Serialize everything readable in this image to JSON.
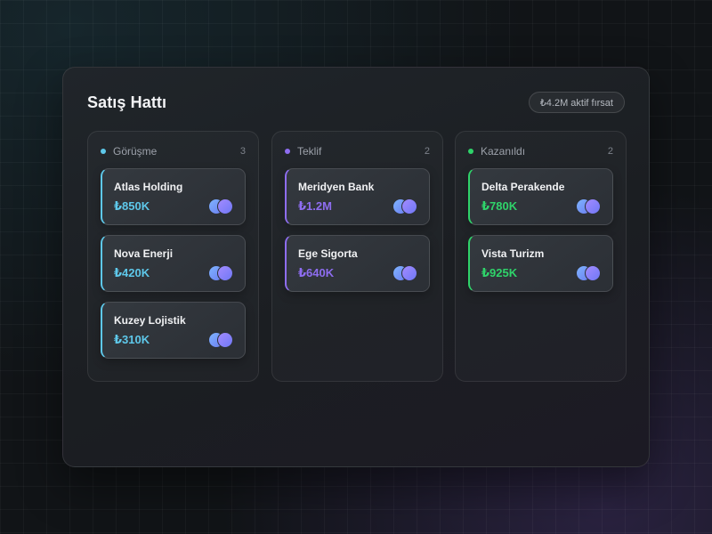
{
  "board": {
    "title": "Satış Hattı",
    "active_badge": "₺4.2M aktif fırsat"
  },
  "columns": [
    {
      "name": "Görüşme",
      "count": "3",
      "color": "#5ec8ea",
      "cards": [
        {
          "name": "Atlas Holding",
          "amount": "₺850K"
        },
        {
          "name": "Nova Enerji",
          "amount": "₺420K"
        },
        {
          "name": "Kuzey Lojistik",
          "amount": "₺310K"
        }
      ]
    },
    {
      "name": "Teklif",
      "count": "2",
      "color": "#8e6df0",
      "cards": [
        {
          "name": "Meridyen Bank",
          "amount": "₺1.2M"
        },
        {
          "name": "Ege Sigorta",
          "amount": "₺640K"
        }
      ]
    },
    {
      "name": "Kazanıldı",
      "count": "2",
      "color": "#2fd36a",
      "cards": [
        {
          "name": "Delta Perakende",
          "amount": "₺780K"
        },
        {
          "name": "Vista Turizm",
          "amount": "₺925K"
        }
      ]
    }
  ],
  "icons": {
    "avatar_group": "avatar-group-icon"
  }
}
